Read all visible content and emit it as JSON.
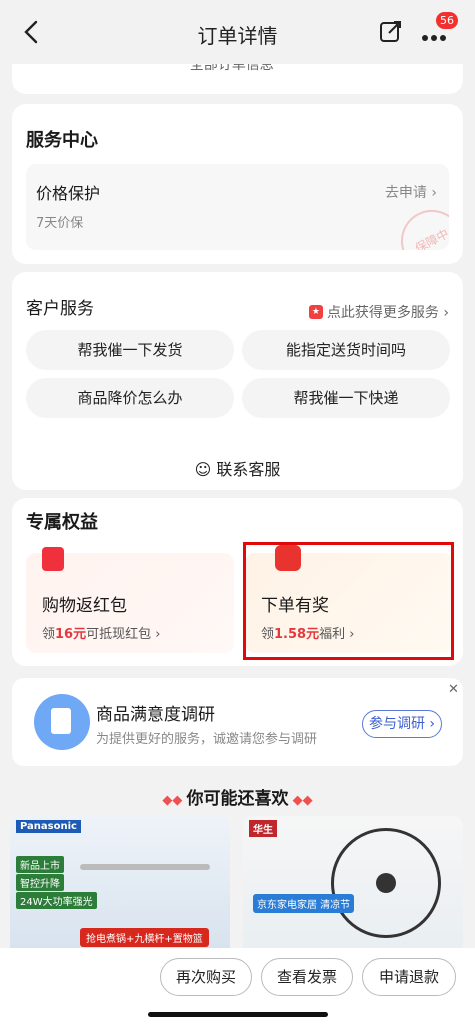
{
  "header": {
    "title": "订单详情",
    "badge": "56"
  },
  "order_info": {
    "all_info_text": "全部订单信息 ˅"
  },
  "service_center": {
    "title": "服务中心",
    "price_protect": {
      "title": "价格保护",
      "subtitle": "7天价保",
      "link": "去申请 ›",
      "stamp": "保障中"
    }
  },
  "customer_service": {
    "title": "客户服务",
    "more_link": "点此获得更多服务 ›",
    "quick_questions": [
      "帮我催一下发货",
      "能指定送货时间吗",
      "商品降价怎么办",
      "帮我催一下快递"
    ],
    "contact_label": "☺ 联系客服"
  },
  "benefits": {
    "title": "专属权益",
    "items": [
      {
        "name": "购物返红包",
        "prefix": "领",
        "amount": "16元",
        "suffix": "可抵现红包 ›"
      },
      {
        "name": "下单有奖",
        "prefix": "领",
        "amount": "1.58元",
        "suffix": "福利 ›"
      }
    ]
  },
  "survey": {
    "title": "商品满意度调研",
    "subtitle": "为提供更好的服务，诚邀请您参与调研",
    "button": "参与调研 ›",
    "close": "✕"
  },
  "recommend": {
    "title": "你可能还喜欢",
    "products": [
      {
        "brand": "Panasonic",
        "tags": [
          "新品上市",
          "智控升降",
          "24W大功率强光"
        ],
        "promo": "抢电煮锅+九横杆+置物篮"
      },
      {
        "brand": "华生",
        "store": "京东家电家居 清凉节"
      }
    ]
  },
  "bottom_bar": {
    "buttons": [
      "再次购买",
      "查看发票",
      "申请退款"
    ]
  },
  "colors": {
    "accent_red": "#e4393c",
    "highlight_border": "#e00a0a",
    "survey_blue": "#3d5fcf"
  }
}
